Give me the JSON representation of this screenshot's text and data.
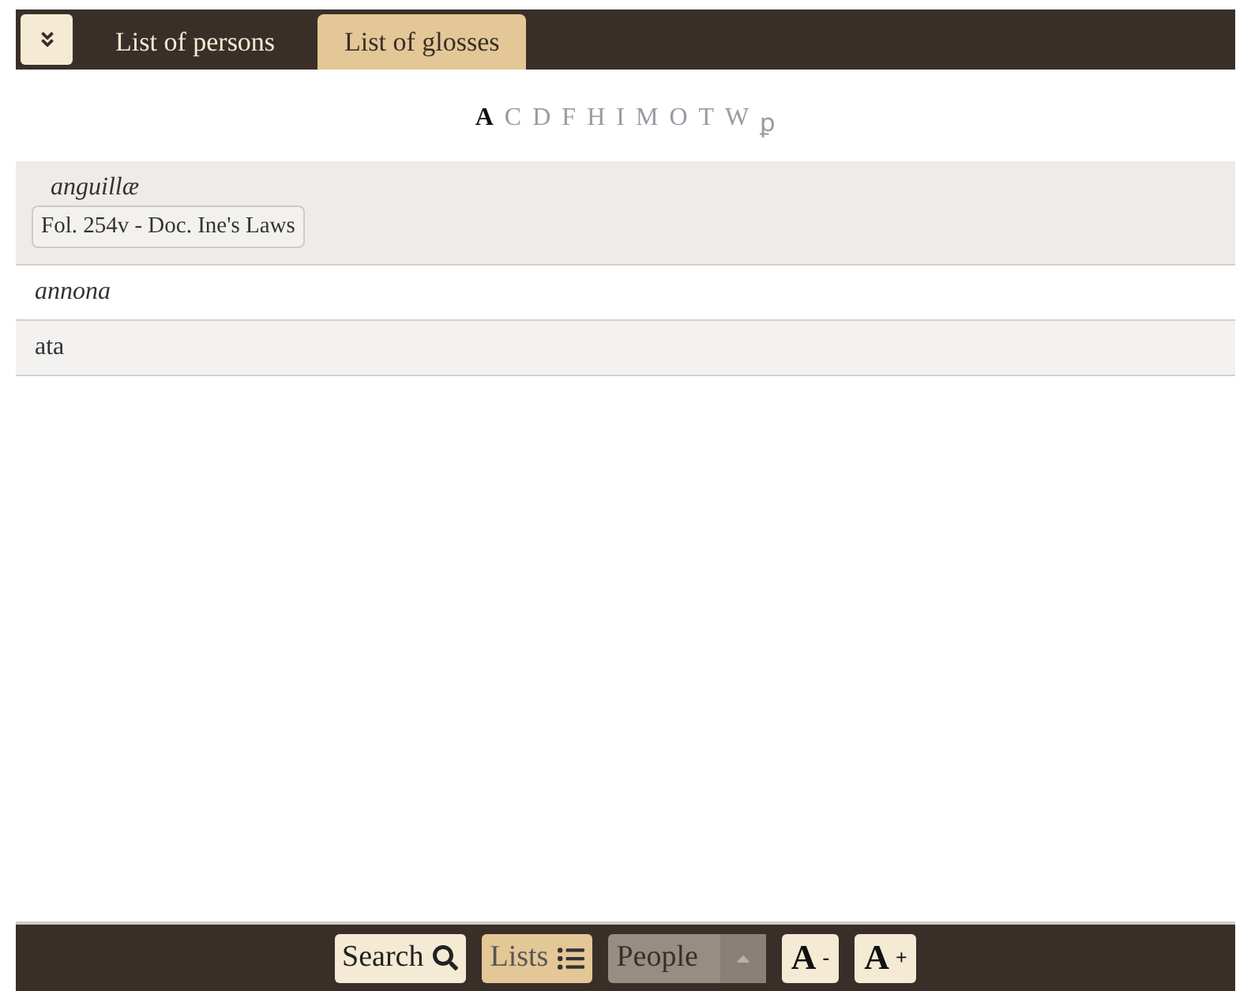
{
  "tabs": [
    {
      "label": "List of persons",
      "selected": false
    },
    {
      "label": "List of glosses",
      "selected": true
    }
  ],
  "letters": [
    {
      "label": "A",
      "selected": true
    },
    {
      "label": "C",
      "selected": false
    },
    {
      "label": "D",
      "selected": false
    },
    {
      "label": "F",
      "selected": false
    },
    {
      "label": "H",
      "selected": false
    },
    {
      "label": "I",
      "selected": false
    },
    {
      "label": "M",
      "selected": false
    },
    {
      "label": "O",
      "selected": false
    },
    {
      "label": "T",
      "selected": false
    },
    {
      "label": "W",
      "selected": false
    },
    {
      "label": "ꝑ",
      "selected": false
    }
  ],
  "glosses": [
    {
      "term": "anguillæ",
      "italic": true,
      "expanded": true,
      "references": [
        "Fol. 254v - Doc. Ine's Laws"
      ]
    },
    {
      "term": "annona",
      "italic": true,
      "expanded": false
    },
    {
      "term": "ata",
      "italic": false,
      "expanded": false
    }
  ],
  "toolbar": [
    {
      "kind": "search",
      "label": "Search",
      "selected": false
    },
    {
      "kind": "lists",
      "label": "Lists",
      "selected": true
    },
    {
      "kind": "people",
      "label": "People",
      "selected": false
    },
    {
      "kind": "font",
      "label": "A",
      "sign": "-"
    },
    {
      "kind": "font",
      "label": "A",
      "sign": "+"
    }
  ]
}
